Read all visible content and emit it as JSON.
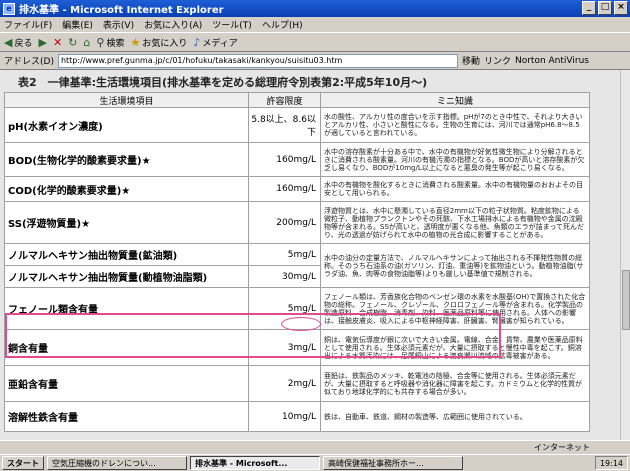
{
  "window": {
    "title": "排水基準 - Microsoft Internet Explorer",
    "controls": [
      "_",
      "□",
      "×"
    ]
  },
  "menu": [
    "ファイル(F)",
    "編集(E)",
    "表示(V)",
    "お気に入り(A)",
    "ツール(T)",
    "ヘルプ(H)"
  ],
  "toolbar": {
    "back": "戻る",
    "search": "検索",
    "favorites": "お気に入り",
    "media": "メディア"
  },
  "address": {
    "label": "アドレス(D)",
    "url": "http://www.pref.gunma.jp/c/01/hofuku/takasaki/kankyou/suisitu03.htm",
    "go": "移動",
    "links": "リンク",
    "antivirus": "Norton AntiVirus"
  },
  "page": {
    "heading": "表2　一律基準:生活環境項目(排水基準を定める総理府令別表第2:平成5年10月〜)",
    "columns": [
      "生活環境項目",
      "許容限度",
      "ミニ知識"
    ],
    "rows": [
      {
        "item": "pH(水素イオン濃度)",
        "limit": "5.8以上、8.6以下",
        "note": "水の酸性、アルカリ性の度合いを示す指標。pHが7のとき中性で、それより大きいとアルカリ性、小さいと酸性になる。生物の生育には、河川では通常pH6.8～8.5が適していると言われている。"
      },
      {
        "item": "BOD(生物化学的酸素要求量)★",
        "limit": "160mg/L",
        "note": "水中の溶存酸素が十分ある中で、水中の有機物が好気性微生物により分解されるときに消費される酸素量。河川の有機汚濁の指標となる。BODが高いと溶存酸素が欠乏し易くなり、BODが10mg/L以上になると悪臭の発生等が起こり易くなる。"
      },
      {
        "item": "COD(化学的酸素要求量)★",
        "limit": "160mg/L",
        "note": "水中の有機物を酸化するときに消費される酸素量。水中の有機物量のおおよその目安として用いられる。"
      },
      {
        "item": "SS(浮遊物質量)★",
        "limit": "200mg/L",
        "note": "浮遊物質とは、水中に懸濁している直径2mm以下の粒子状物質。粘度鉱物による微粒子、動植物プランクトンやその死骸、下水工場排水による有機物や金属の沈殿物等が含まれる。SSが高いと、透明度が悪くなる他、魚類のエラが詰まって死んだり、光の透過が妨げられて水中の植物の光合成に影響することがある。"
      },
      {
        "item": "ノルマルヘキサン抽出物質量(鉱油類)",
        "limit": "5mg/L",
        "note": "水中の油分の定量方法で、ノルマルヘキサンによって抽出される不揮発性物質の総称。そのうち石油系の油(ガソリン、灯油、重油等)を鉱物油という。動植物油脂(サラダ油、魚、肉等の食物油脂等)よりも厳しい基準値で規制される。"
      },
      {
        "item": "ノルマルヘキサン抽出物質量(動植物油脂類)",
        "limit": "30mg/L",
        "note": ""
      },
      {
        "item": "フェノール類含有量",
        "limit": "5mg/L",
        "note": "フェノール類は、芳香族化合物のベンゼン環の水素を水酸基(OH)で置換された化合物の総称。フェノール、クレゾール、クロロフェノール等が含まれる。化学製品の製造原料、合成樹脂、消毒剤、染料、医薬品原料等に使用される。人体への影響は、接触皮膚炎、吸入による中枢神経障害、肝臓害、腎臓害が知られている。"
      },
      {
        "item": "銅含有量",
        "limit": "3mg/L",
        "note": "銅は、電気伝導度が銀に次いで大きい金属。電線、合金、貨幣、農業や医薬品原料として使用される。生体必須元素だが、大量に摂取すると慢性中毒を起こす。銅溶出による水質汚染には、足尾銅山による渡良瀬川流域の鉱毒被害がある。"
      },
      {
        "item": "亜鉛含有量",
        "limit": "2mg/L",
        "note": "亜鉛は、鉄製品のメッキ、乾電池の陰極、合金等に使用される。生体必須元素だが、大量に摂取すると呼吸器や消化器に障害を起こす。カドミウムと化学的性質が似ており地球化学的にも共存する場合が多い。"
      },
      {
        "item": "溶解性鉄含有量",
        "limit": "10mg/L",
        "note": "鉄は、自動車、鉄道、鋼材の製造等、広範囲に使用されている。"
      }
    ]
  },
  "status": {
    "zone": "インターネット"
  },
  "taskbar": {
    "start": "スタート",
    "tasks": [
      "空気圧縮機のドレンについ...",
      "排水基準 - Microsoft...",
      "高崎保健福祉事務所ホー..."
    ],
    "clock": "19:14"
  }
}
